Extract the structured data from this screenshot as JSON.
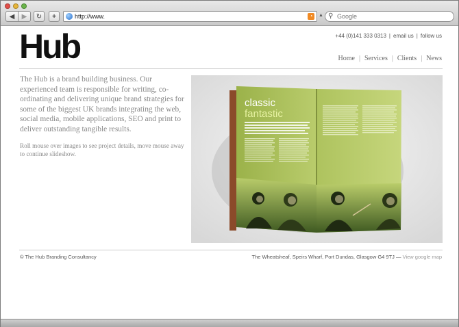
{
  "browser": {
    "url": "http://www.",
    "search_placeholder": "Google",
    "back_label": "◀",
    "forward_label": "▶",
    "reload_label": "↻",
    "add_label": "+"
  },
  "site": {
    "logo": "Hub",
    "contact": {
      "phone": "+44 (0)141 333 0313",
      "email": "email us",
      "follow": "follow us"
    },
    "nav": [
      "Home",
      "Services",
      "Clients",
      "News"
    ],
    "intro": "The Hub is a brand building business. Our experienced team is responsible for writing, co-ordinating and delivering unique brand strategies for some of the biggest UK brands integrating the web, social media, mobile applications, SEO and print to deliver outstanding tangible results.",
    "hint": "Roll mouse over images to see project details, move mouse away to continue slideshow.",
    "magazine": {
      "headline1": "classic",
      "headline2": "fantastic"
    },
    "footer": {
      "copyright": "© The Hub Branding Consultancy",
      "address": "The Wheatsheaf, Speirs Wharf, Port Dundas, Glasgow G4 9TJ",
      "dash": " — ",
      "map": "View google map"
    }
  },
  "colors": {
    "magazine_green": "#a8c05a",
    "text_grey": "#888888"
  }
}
